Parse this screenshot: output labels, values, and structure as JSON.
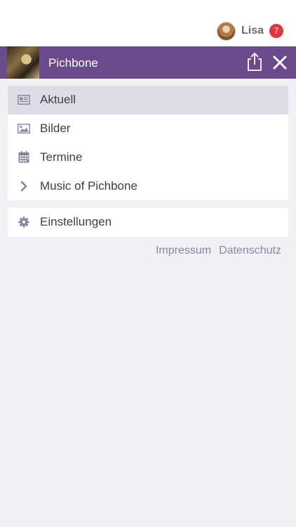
{
  "user": {
    "name": "Lisa",
    "notification_count": "7"
  },
  "header": {
    "title": "Pichbone"
  },
  "menu": {
    "items": [
      {
        "label": "Aktuell",
        "icon": "newspaper-icon",
        "active": true
      },
      {
        "label": "Bilder",
        "icon": "image-icon",
        "active": false
      },
      {
        "label": "Termine",
        "icon": "calendar-icon",
        "active": false
      },
      {
        "label": "Music of Pichbone",
        "icon": "chevron-right-icon",
        "active": false
      }
    ]
  },
  "settings": {
    "label": "Einstellungen",
    "icon": "gear-icon"
  },
  "footer": {
    "impressum": "Impressum",
    "datenschutz": "Datenschutz"
  },
  "colors": {
    "accent": "#6b4a8c",
    "icon": "#8a7fa0",
    "badge": "#e8323c",
    "background": "#f1f0f5"
  }
}
